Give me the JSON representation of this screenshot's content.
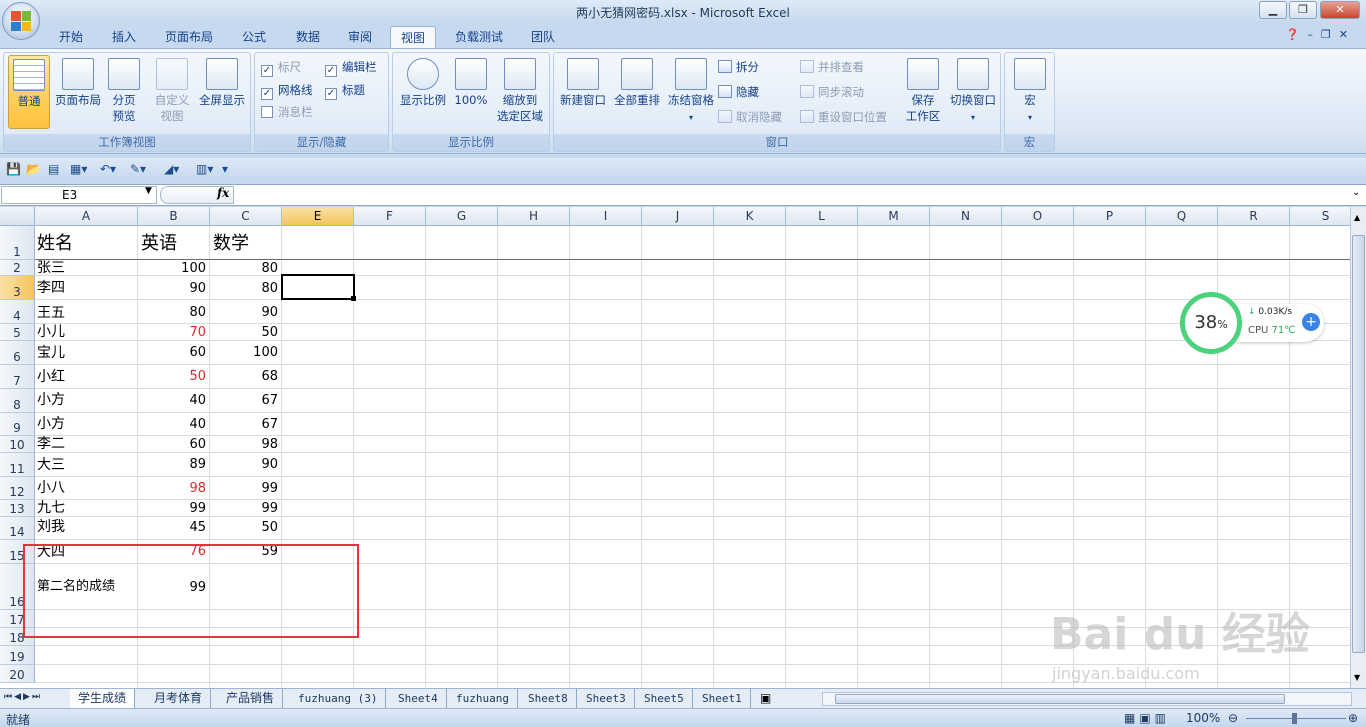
{
  "window": {
    "title": "两小无猜网密码.xlsx - Microsoft Excel"
  },
  "ribbon_tabs": [
    "开始",
    "插入",
    "页面布局",
    "公式",
    "数据",
    "审阅",
    "视图",
    "负载测试",
    "团队"
  ],
  "active_tab": "视图",
  "groups": {
    "workbook_views": {
      "label": "工作簿视图",
      "normal": "普通",
      "page_layout": "页面布局",
      "page_break_1": "分页",
      "page_break_2": "预览",
      "custom_1": "自定义",
      "custom_2": "视图",
      "fullscreen": "全屏显示"
    },
    "show_hide": {
      "label": "显示/隐藏",
      "ruler": "标尺",
      "formula_bar": "编辑栏",
      "gridlines": "网格线",
      "headings": "标题",
      "message_bar": "消息栏"
    },
    "zoom": {
      "label": "显示比例",
      "zoom": "显示比例",
      "hundred": "100%",
      "fit_1": "缩放到",
      "fit_2": "选定区域"
    },
    "window": {
      "label": "窗口",
      "new_window": "新建窗口",
      "arrange_all": "全部重排",
      "freeze": "冻结窗格",
      "split": "拆分",
      "hide": "隐藏",
      "unhide": "取消隐藏",
      "side_by_side": "并排查看",
      "sync_scroll": "同步滚动",
      "reset_pos": "重设窗口位置",
      "save_ws_1": "保存",
      "save_ws_2": "工作区",
      "switch": "切换窗口"
    },
    "macros": {
      "label": "宏",
      "macros": "宏"
    }
  },
  "formula_bar": {
    "name_box": "E3",
    "fx": "fx",
    "content": ""
  },
  "columns": [
    "A",
    "B",
    "C",
    "E",
    "F",
    "G",
    "H",
    "I",
    "J",
    "K",
    "L",
    "M",
    "N",
    "O",
    "P",
    "Q",
    "R",
    "S"
  ],
  "rows": [
    "1",
    "2",
    "3",
    "4",
    "5",
    "6",
    "7",
    "8",
    "9",
    "10",
    "11",
    "12",
    "13",
    "14",
    "15",
    "16",
    "17",
    "18",
    "19",
    "20"
  ],
  "table": {
    "headers": [
      "姓名",
      "英语",
      "数学"
    ],
    "data": [
      {
        "name": "张三",
        "english": "100",
        "math": "80"
      },
      {
        "name": "李四",
        "english": "90",
        "math": "80"
      },
      {
        "name": "王五",
        "english": "80",
        "math": "90"
      },
      {
        "name": "小儿",
        "english": "70",
        "math": "50"
      },
      {
        "name": "宝儿",
        "english": "60",
        "math": "100"
      },
      {
        "name": "小红",
        "english": "50",
        "math": "68"
      },
      {
        "name": "小方",
        "english": "40",
        "math": "67"
      },
      {
        "name": "小方",
        "english": "40",
        "math": "67"
      },
      {
        "name": "李二",
        "english": "60",
        "math": "98"
      },
      {
        "name": "大三",
        "english": "89",
        "math": "90"
      },
      {
        "name": "小八",
        "english": "98",
        "math": "99"
      },
      {
        "name": "九七",
        "english": "99",
        "math": "99"
      },
      {
        "name": "刘我",
        "english": "45",
        "math": "50"
      },
      {
        "name": "大四",
        "english": "76",
        "math": "59"
      }
    ],
    "summary_label": "第二名的成绩",
    "summary_value": "99"
  },
  "sheet_tabs": [
    "学生成绩",
    "月考体育",
    "产品销售",
    "fuzhuang (3)",
    "Sheet4",
    "fuzhuang",
    "Sheet8",
    "Sheet3",
    "Sheet5",
    "Sheet1"
  ],
  "active_sheet": "学生成绩",
  "status": {
    "ready": "就绪",
    "zoom": "100%"
  },
  "widget": {
    "percent": "38",
    "percent_unit": "%",
    "speed": "0.03K/s",
    "cpu_label": "CPU",
    "cpu_temp": "71℃"
  },
  "watermark": {
    "brand": "Bai du 经验",
    "url": "jingyan.baidu.com"
  },
  "colors": {
    "red_value": "#e0292e",
    "highlight_box": "#e5353c",
    "cpu_ring": "#4cd17c"
  }
}
